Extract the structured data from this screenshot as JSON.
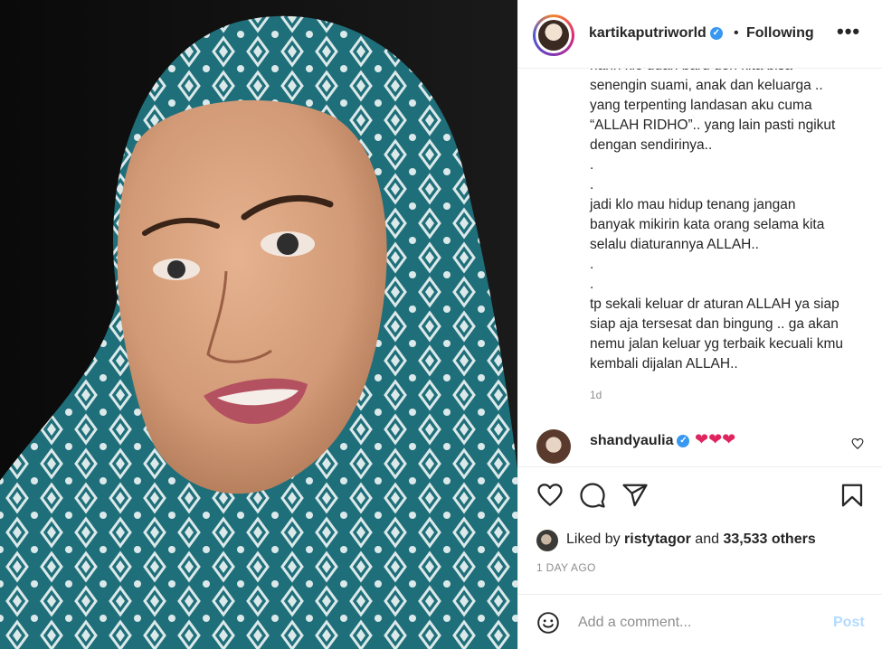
{
  "post": {
    "image_alt": "photo",
    "image_colors": {
      "scarf": "#1f6f7a",
      "scarf_light": "#dce9ea",
      "skin": "#d7a080",
      "background": "#0c0c0c"
    }
  },
  "header": {
    "username": "kartikaputriworld",
    "verified_icon": "verified-badge-icon",
    "separator": "•",
    "follow_status": "Following",
    "more_label": "•••"
  },
  "caption": {
    "text": "hanh klo udah baru deh kita bisa\nsenengin suami, anak dan keluarga ..\nyang terpenting landasan aku cuma\n“ALLAH RIDHO”.. yang lain pasti ngikut\ndengan sendirinya..\n.\n.\njadi klo mau hidup tenang jangan\nbanyak mikirin kata orang selama kita\nselalu diaturannya ALLAH..\n.\n.\ntp sekali keluar dr aturan ALLAH ya siap\nsiap aja tersesat dan bingung .. ga akan\nnemu jalan keluar yg terbaik kecuali kmu\nkembali dijalan ALLAH..",
    "time": "1d"
  },
  "comment": {
    "username": "shandyaulia",
    "text": "❤❤❤",
    "like_icon": "heart-outline-icon"
  },
  "actions": {
    "like_icon": "heart-icon",
    "comment_icon": "comment-icon",
    "share_icon": "share-icon",
    "save_icon": "bookmark-icon"
  },
  "likes": {
    "prefix": "Liked by ",
    "user": "ristytagor",
    "middle": " and ",
    "others": "33,533 others"
  },
  "date": "1 DAY AGO",
  "comment_box": {
    "emoji_icon": "emoji-icon",
    "placeholder": "Add a comment...",
    "post_label": "Post"
  },
  "colors": {
    "verified": "#3897f0",
    "post_button_disabled": "#b3dbff",
    "secondary_text": "#8e8e8e",
    "heart_red": "#e0245e"
  }
}
